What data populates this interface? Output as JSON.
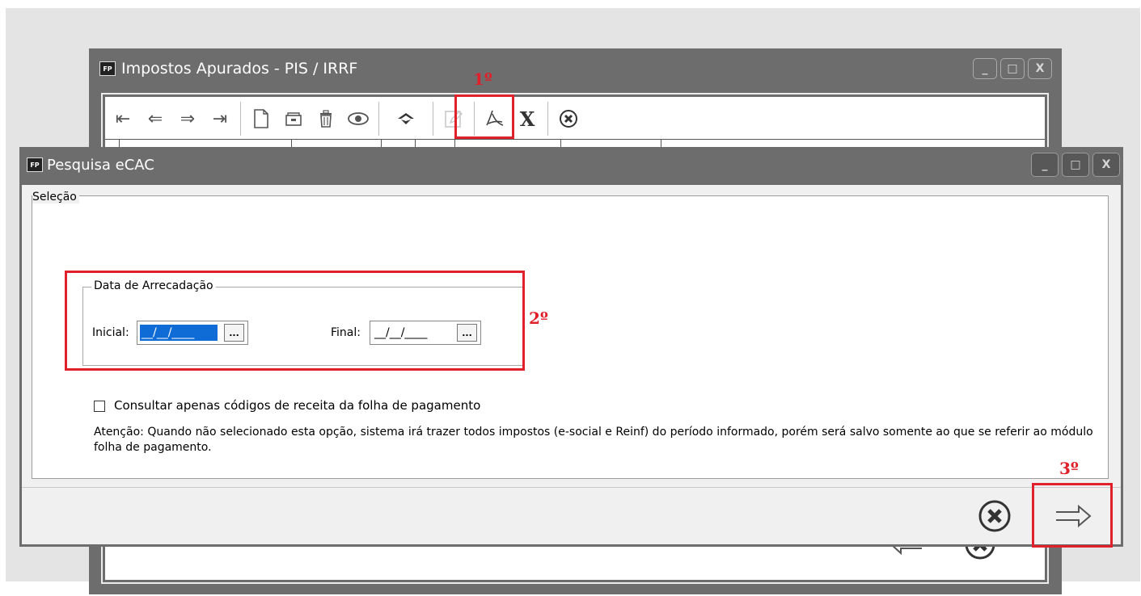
{
  "back_window": {
    "title": "Impostos Apurados - PIS / IRRF",
    "app_badge": "FP",
    "window_buttons": {
      "minimize": "_",
      "maximize": "□",
      "close": "X"
    },
    "toolbar": [
      {
        "name": "first-icon",
        "glyph": "⇤"
      },
      {
        "name": "previous-icon",
        "glyph": "⇐"
      },
      {
        "name": "next-icon",
        "glyph": "⇒"
      },
      {
        "name": "last-icon",
        "glyph": "⇥"
      },
      {
        "name": "new-document-icon"
      },
      {
        "name": "open-folder-icon"
      },
      {
        "name": "trash-icon"
      },
      {
        "name": "view-eye-icon"
      },
      {
        "name": "ecac-icon"
      },
      {
        "name": "edit-icon"
      },
      {
        "name": "pdf-icon"
      },
      {
        "name": "excel-icon",
        "glyph": "X"
      },
      {
        "name": "close-circle-icon"
      }
    ],
    "bottom_buttons": [
      "back-arrow-icon",
      "close-circle-icon"
    ]
  },
  "dialog": {
    "title": "Pesquisa eCAC",
    "app_badge": "FP",
    "window_buttons": {
      "minimize": "_",
      "maximize": "□",
      "close": "X"
    },
    "selection_legend": "Seleção",
    "date_group": {
      "legend": "Data de Arrecadação",
      "initial_label": "Inicial:",
      "initial_value": "__/__/____",
      "final_label": "Final:",
      "final_value": "__/__/____",
      "ellipsis": "..."
    },
    "checkbox_label": "Consultar apenas códigos de receita da folha de pagamento",
    "checkbox_checked": false,
    "note": "Atenção: Quando não selecionado esta opção, sistema irá trazer todos impostos (e-social e Reinf) do período informado, porém será salvo somente ao que se referir ao módulo folha de pagamento."
  },
  "annotations": {
    "step1": "1º",
    "step2": "2º",
    "step3": "3º",
    "color": "#e0202a"
  }
}
